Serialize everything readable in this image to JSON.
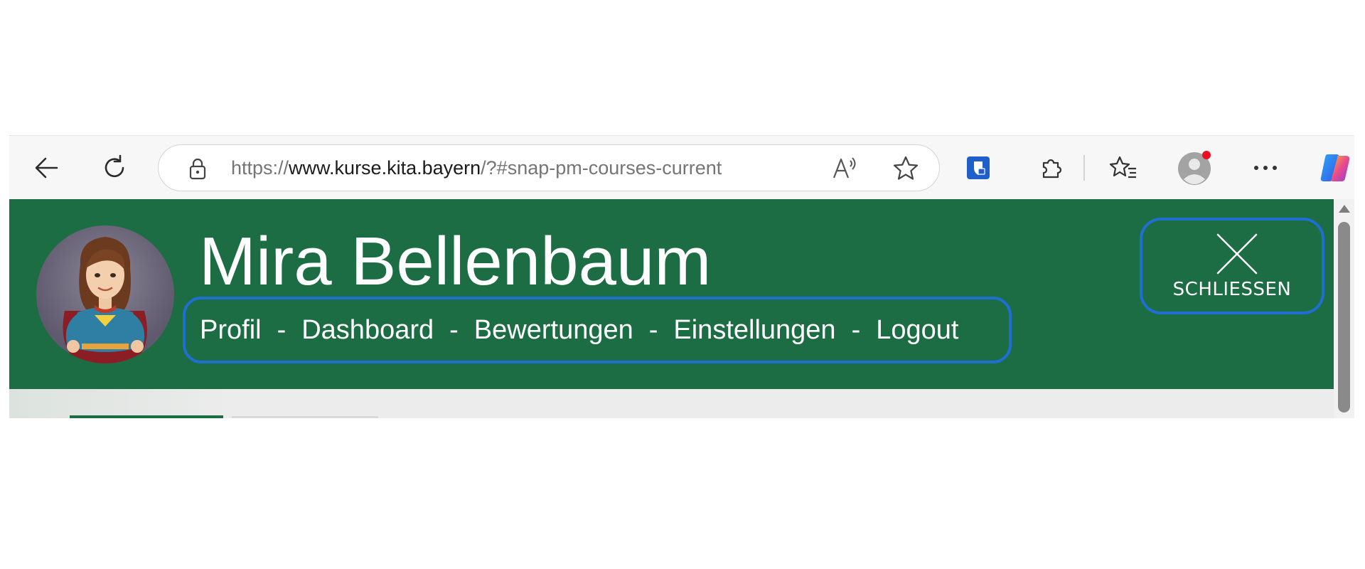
{
  "browser": {
    "url_scheme": "https://",
    "url_host": "www.kurse.kita.bayern",
    "url_path": "/?#snap-pm-courses-current",
    "icons": [
      "back-icon",
      "refresh-icon",
      "lock-icon",
      "read-aloud-icon",
      "favorite-star-icon",
      "shield-extension-icon",
      "extensions-icon",
      "favorites-icon",
      "profile-icon",
      "more-icon",
      "copilot-icon"
    ],
    "profile_dot_color": "#e81123"
  },
  "header": {
    "background_color": "#1c6d43",
    "user_name": "Mira Bellenbaum",
    "nav": [
      {
        "label": "Profil"
      },
      {
        "label": "Dashboard"
      },
      {
        "label": "Bewertungen"
      },
      {
        "label": "Einstellungen"
      },
      {
        "label": "Logout"
      }
    ],
    "nav_separator": "-",
    "close_label": "SCHLIESSEN",
    "highlight_color": "#1f6fd1"
  }
}
